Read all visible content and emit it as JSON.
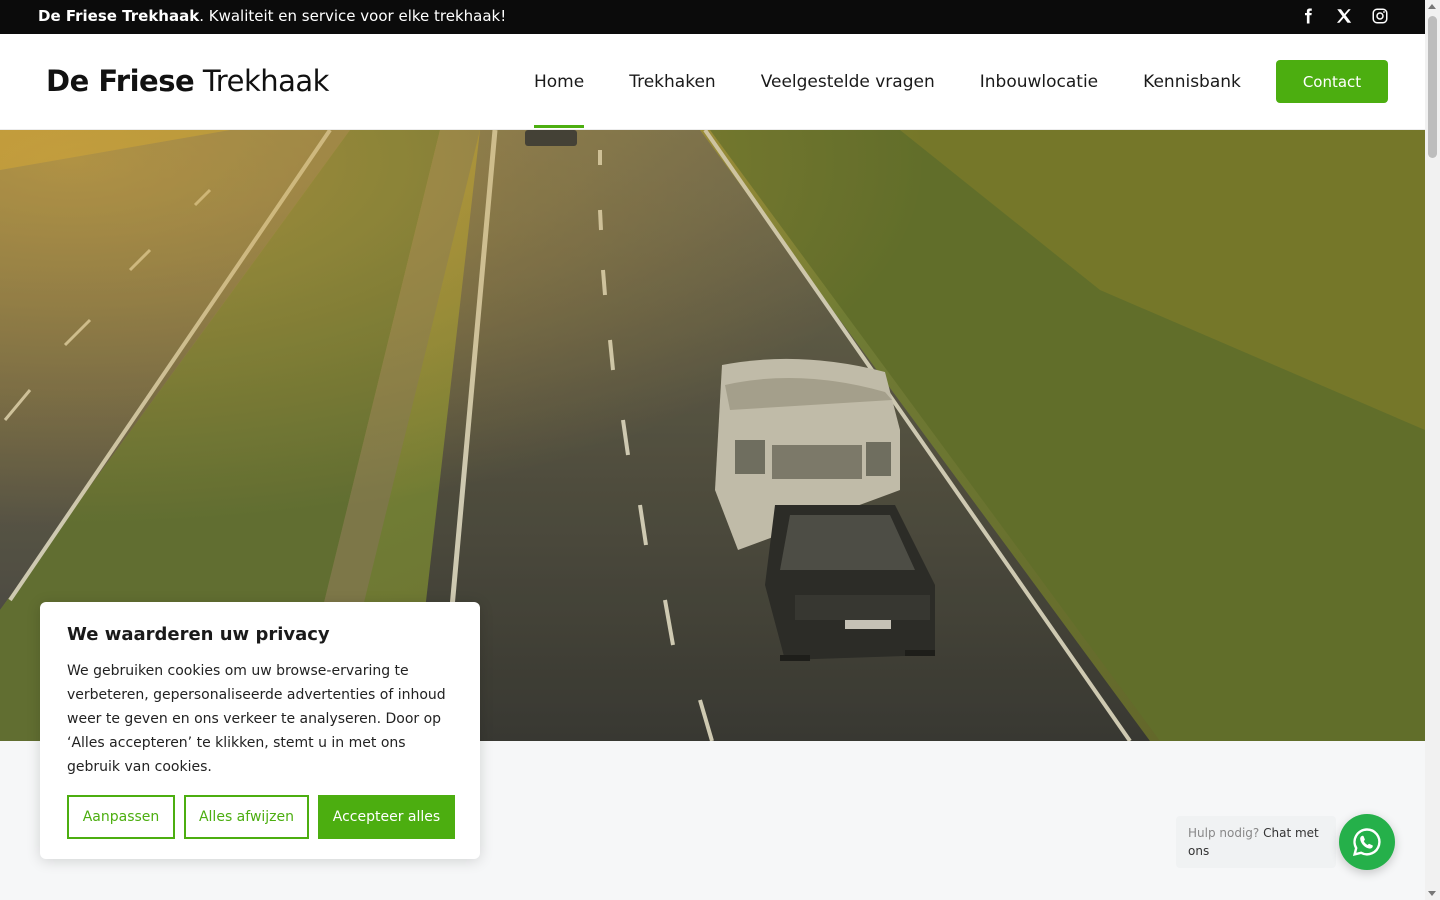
{
  "topbar": {
    "brand": "De Friese Trekhaak",
    "tagline_rest": ". Kwaliteit en service voor elke trekhaak!",
    "social": [
      "facebook-icon",
      "x-icon",
      "instagram-icon"
    ]
  },
  "header": {
    "logo_bold": "De Friese",
    "logo_light": "Trekhaak",
    "nav": [
      {
        "label": "Home",
        "active": true
      },
      {
        "label": "Trekhaken"
      },
      {
        "label": "Veelgestelde vragen"
      },
      {
        "label": "Inbouwlocatie"
      },
      {
        "label": "Kennisbank"
      }
    ],
    "contact_label": "Contact"
  },
  "cookie": {
    "title": "We waarderen uw privacy",
    "body": "We gebruiken cookies om uw browse-ervaring te verbeteren, gepersonaliseerde advertenties of inhoud weer te geven en ons verkeer te analyseren. Door op ‘Alles accepteren’ te klikken, stemt u in met ons gebruik van cookies.",
    "customize_label": "Aanpassen",
    "reject_label": "Alles afwijzen",
    "accept_label": "Accepteer alles"
  },
  "chat": {
    "hint_prefix": "Hulp nodig?",
    "hint_emphasis": "Chat met ons",
    "icon": "whatsapp-icon"
  },
  "colors": {
    "accent": "#4cae10",
    "topbar_bg": "#0b0b0b",
    "whatsapp": "#25b04a"
  }
}
